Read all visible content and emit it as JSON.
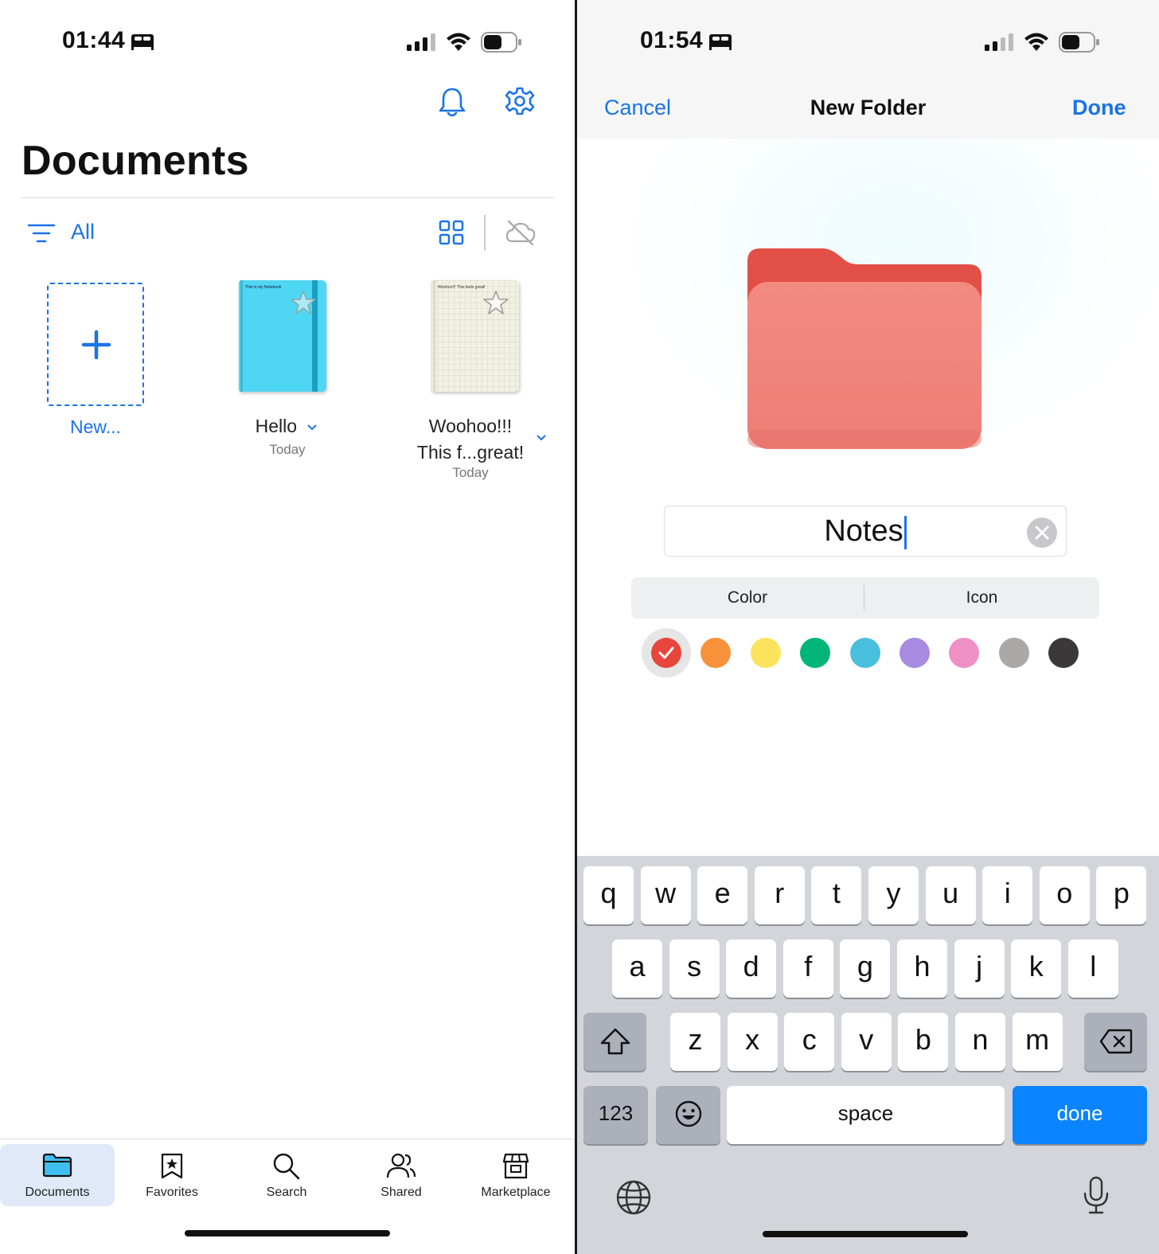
{
  "left": {
    "status": {
      "time": "01:44"
    },
    "header": {
      "title": "Documents"
    },
    "filter": {
      "label": "All"
    },
    "items": [
      {
        "name": "New...",
        "type": "new"
      },
      {
        "name": "Hello",
        "date": "Today",
        "cover_text": "This is my Notebook",
        "cover_color": "#4fd6f2"
      },
      {
        "name_line1": "Woohoo!!!",
        "name_line2": "This f...great!",
        "date": "Today",
        "cover_text": "Woohoo!!! This feels great!",
        "cover_color": "#f3f1e3"
      }
    ],
    "tabs": [
      {
        "label": "Documents",
        "icon": "folder-icon",
        "active": true
      },
      {
        "label": "Favorites",
        "icon": "star-bookmark-icon"
      },
      {
        "label": "Search",
        "icon": "search-icon"
      },
      {
        "label": "Shared",
        "icon": "people-icon"
      },
      {
        "label": "Marketplace",
        "icon": "store-icon"
      }
    ]
  },
  "right": {
    "status": {
      "time": "01:54"
    },
    "nav": {
      "cancel": "Cancel",
      "title": "New Folder",
      "done": "Done"
    },
    "folder": {
      "name": "Notes",
      "color": "#f28279"
    },
    "segments": {
      "color": "Color",
      "icon": "Icon"
    },
    "colors": [
      "#e8453c",
      "#f7923a",
      "#fbe35d",
      "#00b578",
      "#48c0dd",
      "#a68be0",
      "#ee90c6",
      "#aba8a7",
      "#3a3838"
    ],
    "selected_color_index": 0,
    "keyboard": {
      "row1": [
        "q",
        "w",
        "e",
        "r",
        "t",
        "y",
        "u",
        "i",
        "o",
        "p"
      ],
      "row2": [
        "a",
        "s",
        "d",
        "f",
        "g",
        "h",
        "j",
        "k",
        "l"
      ],
      "row3": [
        "z",
        "x",
        "c",
        "v",
        "b",
        "n",
        "m"
      ],
      "numbers": "123",
      "space": "space",
      "done": "done"
    }
  }
}
